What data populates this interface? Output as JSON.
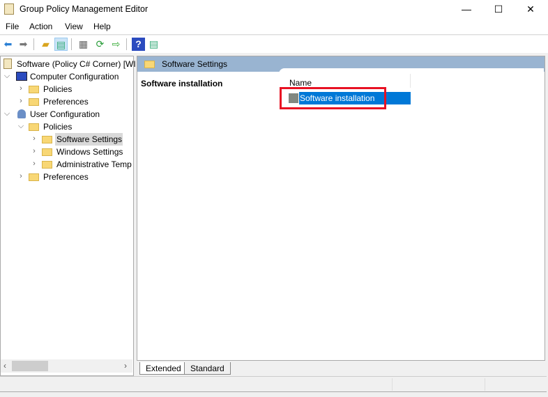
{
  "window": {
    "title": "Group Policy Management Editor",
    "minimize": "—",
    "maximize": "☐",
    "close": "✕"
  },
  "menu": [
    "File",
    "Action",
    "View",
    "Help"
  ],
  "tree": {
    "root": "Software (Policy C# Corner) [WI",
    "items": [
      "Computer Configuration",
      "Policies",
      "Preferences",
      "User Configuration",
      "Policies",
      "Software Settings",
      "Windows Settings",
      "Administrative Temp",
      "Preferences"
    ]
  },
  "right": {
    "header": "Software Settings",
    "left_title": "Software installation",
    "column_name": "Name",
    "rows": [
      "Software installation"
    ]
  },
  "tabs": [
    "Extended",
    "Standard"
  ],
  "colors": {
    "selection": "#0078d7",
    "highlight_box": "#e81123",
    "header": "#99b4d1"
  }
}
